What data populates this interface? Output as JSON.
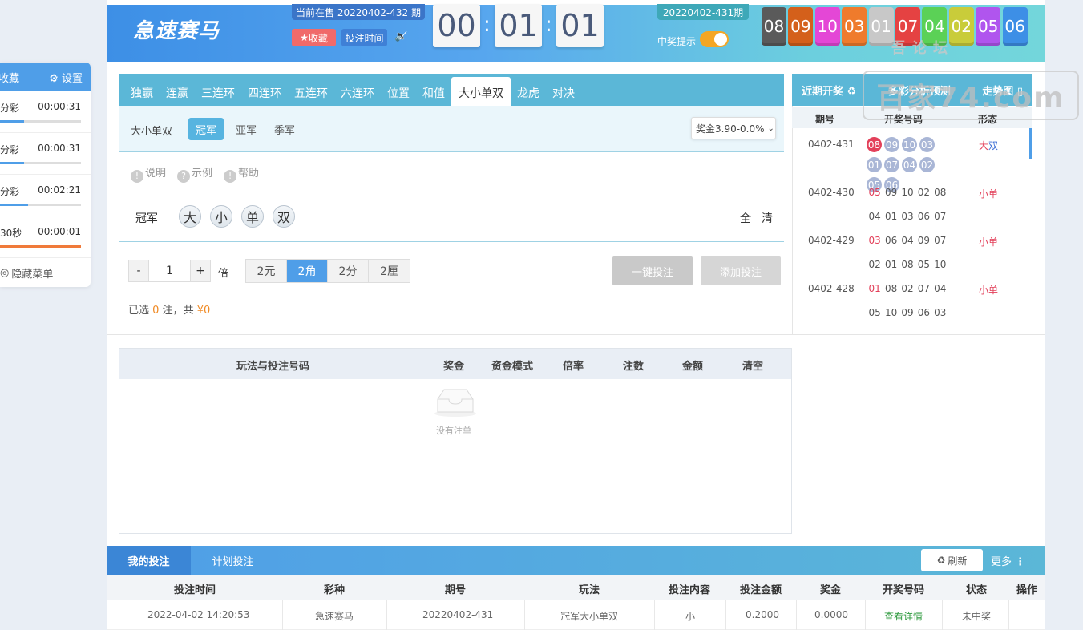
{
  "sidebar": {
    "favorites_label": "收藏",
    "settings_label": "设置",
    "items": [
      {
        "name": "分彩",
        "time": "00:00:31",
        "progress": 0.3
      },
      {
        "name": "分彩",
        "time": "00:00:31",
        "progress": 0.3
      },
      {
        "name": "分彩",
        "time": "00:02:21",
        "progress": 0.35
      },
      {
        "name": "30秒",
        "time": "00:00:01",
        "progress": 1.0
      }
    ],
    "hide_menu_label": "隐藏菜单",
    "accent": "#4f9ee8",
    "last_bar_color": "#f07a3a"
  },
  "header": {
    "logo_text": "急速赛马",
    "current_issue": "当前在售 20220402-432 期",
    "favorite_label": "收藏",
    "bet_time_label": "投注时间",
    "countdown": {
      "hours": "00",
      "minutes": "01",
      "seconds": "01"
    },
    "last_issue": "20220402-431期",
    "win_tip_label": "中奖提示",
    "results": [
      {
        "num": "08",
        "color": "#5a5a5a"
      },
      {
        "num": "09",
        "color": "#d4601b"
      },
      {
        "num": "10",
        "color": "#e447d6"
      },
      {
        "num": "03",
        "color": "#ef7b2c"
      },
      {
        "num": "01",
        "color": "#c8c8c8"
      },
      {
        "num": "07",
        "color": "#e54242"
      },
      {
        "num": "04",
        "color": "#5bd156"
      },
      {
        "num": "02",
        "color": "#c9cc3a"
      },
      {
        "num": "05",
        "color": "#b055ee"
      },
      {
        "num": "06",
        "color": "#3d8fe6"
      }
    ]
  },
  "play": {
    "tabs": [
      "独赢",
      "连赢",
      "三连环",
      "四连环",
      "五连环",
      "六连环",
      "位置",
      "和值",
      "大小单双",
      "龙虎",
      "对决"
    ],
    "active_tab": "大小单双",
    "sub_label": "大小单双",
    "sub_tabs": [
      "冠军",
      "亚军",
      "季军"
    ],
    "active_sub_tab": "冠军",
    "prize_select": "奖金3.90-0.0%",
    "help_links": [
      "说明",
      "示例",
      "帮助"
    ],
    "position_label": "冠军",
    "options": [
      "大",
      "小",
      "单",
      "双"
    ],
    "quick_all": "全",
    "quick_clear": "清",
    "multiplier": "1",
    "multiplier_unit": "倍",
    "units": [
      "2元",
      "2角",
      "2分",
      "2厘"
    ],
    "active_unit": "2角",
    "quick_bet_label": "一键投注",
    "add_bet_label": "添加投注",
    "selected_prefix": "已选",
    "selected_count": "0",
    "selected_mid": "注，共",
    "selected_amount": "¥0"
  },
  "recent": {
    "tabs": [
      "近期开奖 ♻",
      "多彩分析预测",
      "走势图 ▯"
    ],
    "headers": [
      "期号",
      "开奖号码",
      "形态"
    ],
    "rows": [
      {
        "issue": "0402-431",
        "nums": [
          "08",
          "09",
          "10",
          "03",
          "01",
          "07",
          "04",
          "02",
          "05",
          "06"
        ],
        "shape_a": "大",
        "shape_b": "双",
        "style": "balls"
      },
      {
        "issue": "0402-430",
        "nums": [
          "05",
          "09",
          "10",
          "02",
          "08",
          "04",
          "01",
          "03",
          "06",
          "07"
        ],
        "shape_a": "小",
        "shape_b": "单",
        "style": "plain"
      },
      {
        "issue": "0402-429",
        "nums": [
          "03",
          "06",
          "04",
          "09",
          "07",
          "02",
          "01",
          "08",
          "05",
          "10"
        ],
        "shape_a": "小",
        "shape_b": "单",
        "style": "plain"
      },
      {
        "issue": "0402-428",
        "nums": [
          "01",
          "08",
          "02",
          "07",
          "04",
          "05",
          "10",
          "09",
          "06",
          "03"
        ],
        "shape_a": "小",
        "shape_b": "单",
        "style": "plain"
      }
    ]
  },
  "bet_list": {
    "headers": [
      "玩法与投注号码",
      "奖金",
      "资金模式",
      "倍率",
      "注数",
      "金额",
      "清空"
    ],
    "empty_text": "没有注单"
  },
  "watermark": {
    "text": "百家74.com",
    "top_text": "吾论坛"
  },
  "my_bets": {
    "tabs": [
      "我的投注",
      "计划投注"
    ],
    "refresh_label": "刷新",
    "more_label": "更多",
    "headers": [
      "投注时间",
      "彩种",
      "期号",
      "玩法",
      "投注内容",
      "投注金额",
      "奖金",
      "开奖号码",
      "状态",
      "操作"
    ],
    "rows": [
      {
        "time": "2022-04-02 14:20:53",
        "lottery": "急速赛马",
        "issue": "20220402-431",
        "play": "冠军大小单双",
        "content": "小",
        "amount": "0.2000",
        "prize": "0.0000",
        "draw": "查看详情",
        "status": "未中奖",
        "action": ""
      }
    ]
  }
}
